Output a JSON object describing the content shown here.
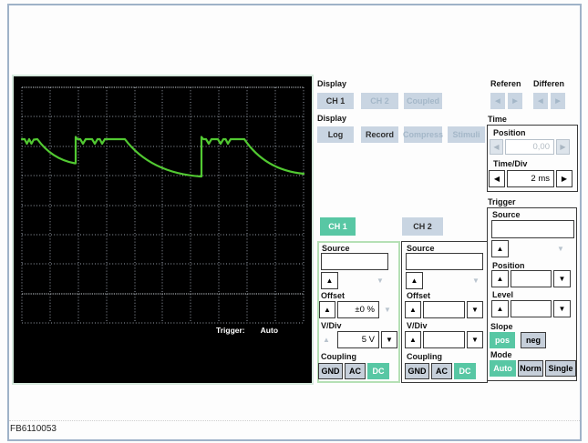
{
  "window": {
    "footer_code": "FB6110053"
  },
  "icons": {
    "up": "▲",
    "down": "▼",
    "left": "◀",
    "right": "▶"
  },
  "colors": {
    "accent_teal": "#58c7a4",
    "waveform_green": "#52c932",
    "button_bg": "#c9d5e2",
    "channel1_panel_border": "#b5e0b5",
    "frame_border": "#9fb2c8",
    "scope_background": "#000000"
  },
  "scope": {
    "trigger_label": "Trigger:",
    "trigger_mode": "Auto"
  },
  "display_channel_section": {
    "title": "Display",
    "ch1": "CH 1",
    "ch2": "CH 2",
    "coupled": "Coupled"
  },
  "display_mode_section": {
    "title": "Display",
    "log": "Log",
    "record": "Record",
    "compress": "Compress",
    "stimuli": "Stimuli"
  },
  "reference_section": {
    "referen": "Referen",
    "differen": "Differen"
  },
  "time_section": {
    "title": "Time",
    "position_label": "Position",
    "position_value": "0,00",
    "timediv_label": "Time/Div",
    "timediv_value": "2 ms"
  },
  "trigger_section": {
    "title": "Trigger",
    "source_label": "Source",
    "source_value": "",
    "position_label": "Position",
    "position_value": "",
    "level_label": "Level",
    "level_value": "",
    "slope_label": "Slope",
    "slope_pos": "pos",
    "slope_neg": "neg",
    "mode_label": "Mode",
    "mode_auto": "Auto",
    "mode_norm": "Norm",
    "mode_single": "Single"
  },
  "channel1": {
    "tab": "CH 1",
    "source_label": "Source",
    "source_value": "",
    "offset_label": "Offset",
    "offset_value": "±0 %",
    "vdiv_label": "V/Div",
    "vdiv_value": "5 V",
    "coupling_label": "Coupling",
    "gnd": "GND",
    "ac": "AC",
    "dc": "DC"
  },
  "channel2": {
    "tab": "CH 2",
    "source_label": "Source",
    "source_value": "",
    "offset_label": "Offset",
    "offset_value": "",
    "vdiv_label": "V/Div",
    "vdiv_value": "",
    "coupling_label": "Coupling",
    "gnd": "GND",
    "ac": "AC",
    "dc": "DC"
  }
}
